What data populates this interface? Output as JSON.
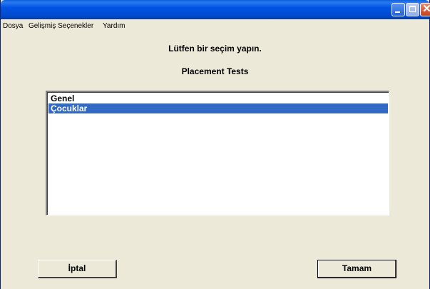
{
  "window": {
    "title": ""
  },
  "menu": {
    "items": [
      {
        "label": "Dosya"
      },
      {
        "label": "Gelişmiş Seçenekler"
      },
      {
        "label": "Yardım"
      }
    ]
  },
  "main": {
    "prompt": "Lütfen bir seçim yapın.",
    "subtitle": "Placement Tests",
    "list": {
      "items": [
        {
          "label": "Genel",
          "selected": false
        },
        {
          "label": "Çocuklar",
          "selected": true
        }
      ]
    }
  },
  "buttons": {
    "cancel_label": "İptal",
    "ok_label": "Tamam"
  },
  "colors": {
    "titlebar": "#0054e3",
    "selection": "#316ac5",
    "dialog_bg": "#ece9d8"
  }
}
